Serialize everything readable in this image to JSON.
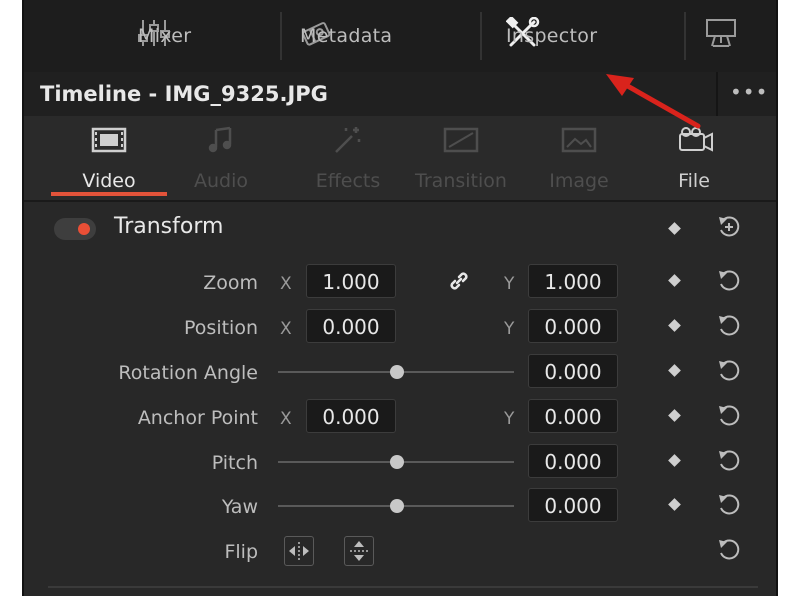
{
  "topbar": {
    "mixer_label": "Mixer",
    "metadata_label": "Metadata",
    "inspector_label": "Inspector"
  },
  "title": {
    "text": "Timeline - IMG_9325.JPG",
    "more": "•••"
  },
  "tabs": [
    {
      "label": "Video",
      "icon": "filmstrip-icon",
      "state": "active"
    },
    {
      "label": "Audio",
      "icon": "music-note-icon",
      "state": "disabled"
    },
    {
      "label": "Effects",
      "icon": "magic-wand-icon",
      "state": "disabled"
    },
    {
      "label": "Transition",
      "icon": "transition-icon",
      "state": "disabled"
    },
    {
      "label": "Image",
      "icon": "image-icon",
      "state": "disabled"
    },
    {
      "label": "File",
      "icon": "camera-icon",
      "state": "enabled"
    }
  ],
  "transform": {
    "title": "Transform",
    "enabled": true,
    "zoom": {
      "label": "Zoom",
      "x_axis": "X",
      "x": "1.000",
      "y_axis": "Y",
      "y": "1.000"
    },
    "position": {
      "label": "Position",
      "x_axis": "X",
      "x": "0.000",
      "y_axis": "Y",
      "y": "0.000"
    },
    "rotation": {
      "label": "Rotation Angle",
      "value": "0.000"
    },
    "anchor": {
      "label": "Anchor Point",
      "x_axis": "X",
      "x": "0.000",
      "y_axis": "Y",
      "y": "0.000"
    },
    "pitch": {
      "label": "Pitch",
      "value": "0.000"
    },
    "yaw": {
      "label": "Yaw",
      "value": "0.000"
    },
    "flip": {
      "label": "Flip"
    }
  },
  "colors": {
    "accent": "#e2533a",
    "annotation_arrow": "#d9231c"
  }
}
